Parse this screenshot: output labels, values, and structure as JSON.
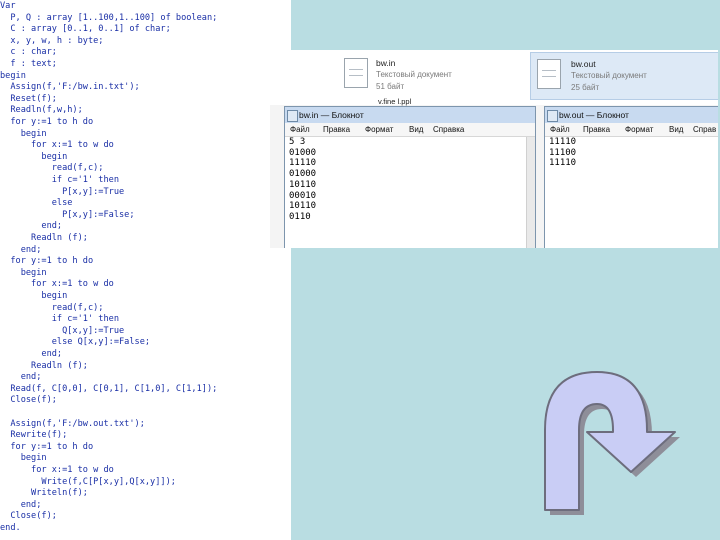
{
  "code_lines": [
    "Var",
    "  P, Q : array [1..100,1..100] of boolean;",
    "  C : array [0..1, 0..1] of char;",
    "  x, y, w, h : byte;",
    "  c : char;",
    "  f : text;",
    "begin",
    "  Assign(f,'F:/bw.in.txt');",
    "  Reset(f);",
    "  Readln(f,w,h);",
    "  for y:=1 to h do",
    "    begin",
    "      for x:=1 to w do",
    "        begin",
    "          read(f,c);",
    "          if c='1' then",
    "            P[x,y]:=True",
    "          else",
    "            P[x,y]:=False;",
    "        end;",
    "      Readln (f);",
    "    end;",
    "  for y:=1 to h do",
    "    begin",
    "      for x:=1 to w do",
    "        begin",
    "          read(f,c);",
    "          if c='1' then",
    "            Q[x,y]:=True",
    "          else Q[x,y]:=False;",
    "        end;",
    "      Readln (f);",
    "    end;",
    "  Read(f, C[0,0], C[0,1], C[1,0], C[1,1]);",
    "  Close(f);",
    "",
    "  Assign(f,'F:/bw.out.txt');",
    "  Rewrite(f);",
    "  for y:=1 to h do",
    "    begin",
    "      for x:=1 to w do",
    "        Write(f,C[P[x,y],Q[x,y]]);",
    "      Writeln(f);",
    "    end;",
    "  Close(f);",
    "end."
  ],
  "explorer": {
    "files": [
      {
        "name": "bw.in",
        "type": "Текстовый документ",
        "size": "51 байт"
      },
      {
        "name": "bw.out",
        "type": "Текстовый документ",
        "size": "25 байт"
      }
    ],
    "partial_file": "v.fine l.ppl"
  },
  "notepad_in": {
    "title": "bw.in — Блокнот",
    "menu": [
      "Файл",
      "Правка",
      "Формат",
      "Вид",
      "Справка"
    ],
    "lines": [
      "5 3",
      "01000",
      "11110",
      "01000",
      "10110",
      "00010",
      "10110",
      "0110"
    ]
  },
  "notepad_out": {
    "title": "bw.out — Блокнот",
    "menu": [
      "Файл",
      "Правка",
      "Формат",
      "Вид",
      "Справ"
    ],
    "lines": [
      "11110",
      "11100",
      "11110"
    ]
  },
  "colors": {
    "code_text": "#1a2fa6",
    "background": "#b9dde2",
    "arrow_fill": "#c9cdf5",
    "arrow_stroke": "#6d6d7d"
  },
  "icons": [
    "file-icon",
    "notepad-icon",
    "u-turn-arrow-icon"
  ]
}
